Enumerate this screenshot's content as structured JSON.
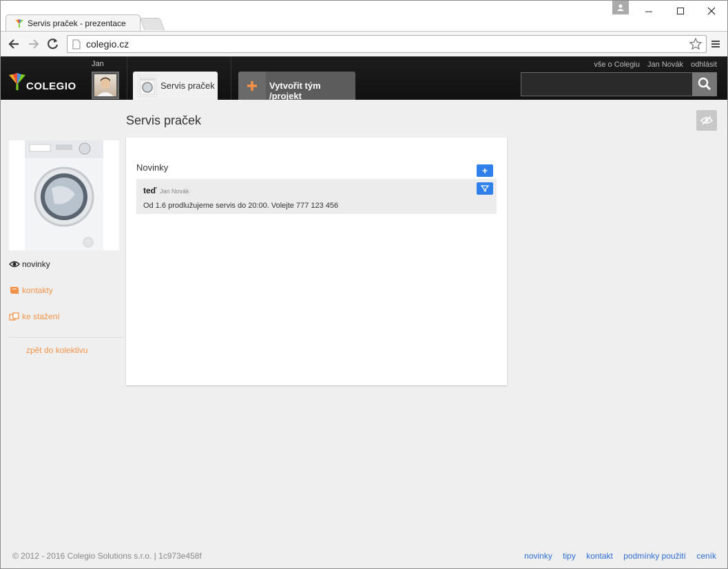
{
  "browser": {
    "tab_title": "Servis praček - prezentace",
    "url": "colegio.cz"
  },
  "header": {
    "logo_text": "COLEGIO",
    "user_name": "Jan",
    "team_tab_label": "Servis praček",
    "create_button_label": "Vytvořit tým /projekt",
    "top_links": [
      "vše o Colegiu",
      "Jan Novák",
      "odhlásit"
    ],
    "search_placeholder": ""
  },
  "page": {
    "title": "Servis praček"
  },
  "sidebar": {
    "items": [
      {
        "label": "novinky",
        "icon": "eye-icon",
        "active": true
      },
      {
        "label": "kontakty",
        "icon": "book-icon",
        "active": false
      },
      {
        "label": "ke stažení",
        "icon": "copy-icon",
        "active": false
      }
    ],
    "back_label": "zpět do kolektivu"
  },
  "news": {
    "title": "Novinky",
    "add_label": "+",
    "items": [
      {
        "time": "teď",
        "author": "Jan Novák",
        "text": "Od 1.6 prodlužujeme servis do 20:00. Volejte 777 123 456"
      }
    ]
  },
  "footer": {
    "copyright": "© 2012 - 2016 Colegio Solutions s.r.o. | 1c973e458f",
    "links": [
      "novinky",
      "tipy",
      "kontakt",
      "podmínky použití",
      "ceník"
    ]
  },
  "colors": {
    "accent_orange": "#f29248",
    "accent_blue": "#2f80ed",
    "header_bg": "#1a1a1a"
  }
}
